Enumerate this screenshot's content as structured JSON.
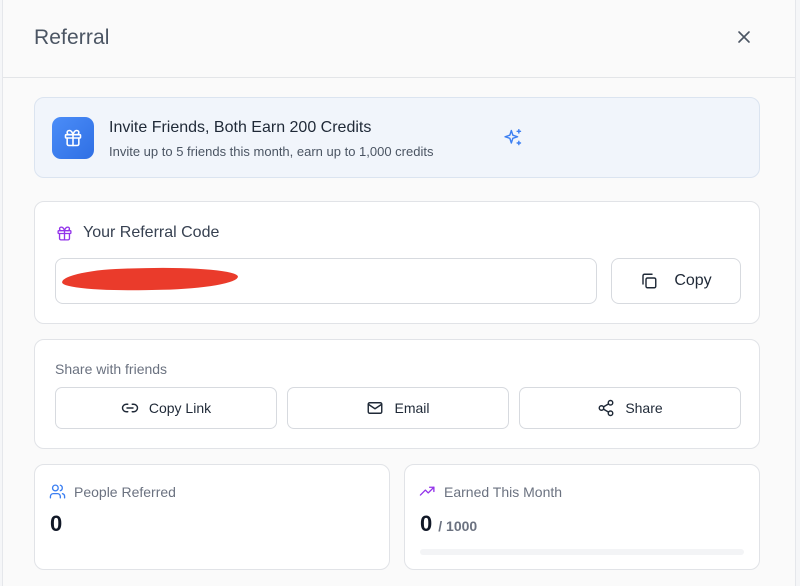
{
  "header": {
    "title": "Referral",
    "close_icon": "close-icon"
  },
  "banner": {
    "icon": "gift-icon",
    "title": "Invite Friends, Both Earn 200 Credits",
    "subtitle": "Invite up to 5 friends this month, earn up to 1,000 credits",
    "accent_icon": "sparkle-icon",
    "accent_color": "#3b7ff2"
  },
  "referral_code": {
    "label": "Your Referral Code",
    "label_icon": "gift-icon",
    "label_icon_color": "#9333ea",
    "value": "",
    "redacted": true,
    "copy_button_label": "Copy"
  },
  "share": {
    "title": "Share with friends",
    "buttons": [
      {
        "label": "Copy Link",
        "icon": "link-icon"
      },
      {
        "label": "Email",
        "icon": "mail-icon"
      },
      {
        "label": "Share",
        "icon": "share-icon"
      }
    ]
  },
  "stats": {
    "people_referred": {
      "label": "People Referred",
      "icon": "users-icon",
      "icon_color": "#3b7ff2",
      "value": "0"
    },
    "earned_this_month": {
      "label": "Earned This Month",
      "icon": "trending-up-icon",
      "icon_color": "#9333ea",
      "value": "0",
      "max": "/ 1000",
      "progress": 0
    }
  }
}
